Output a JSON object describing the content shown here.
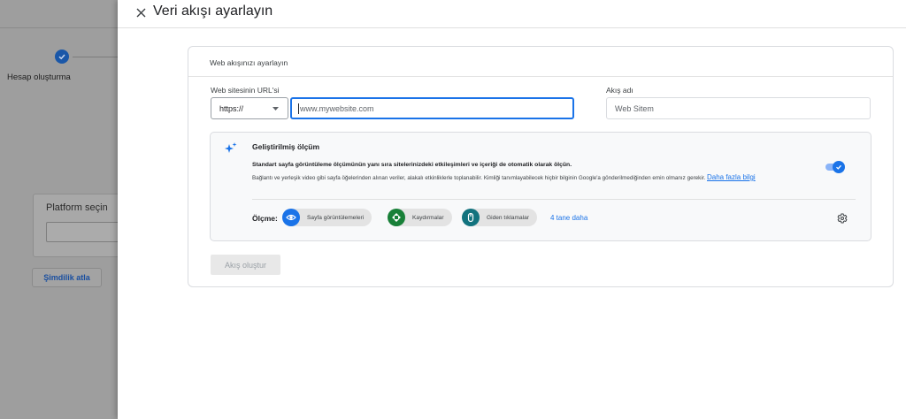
{
  "background": {
    "step_label": "Hesap oluşturma",
    "platform_card_title": "Platform seçin",
    "skip_button": "Şimdilik atla"
  },
  "dialog": {
    "title": "Veri akışı ayarlayın",
    "card_title": "Web akışınızı ayarlayın",
    "url_label": "Web sitesinin URL'si",
    "protocol_value": "https://",
    "url_placeholder": "www.mywebsite.com",
    "stream_name_label": "Akış adı",
    "stream_name_placeholder": "Web Sitem",
    "enhanced": {
      "title": "Geliştirilmiş ölçüm",
      "desc_bold": "Standart sayfa görüntüleme ölçümünün yanı sıra sitelerinizdeki etkileşimleri ve içeriği de otomatik olarak ölçün.",
      "desc_text": "Bağlantı ve yerleşik video gibi sayfa öğelerinden alınan veriler, alakalı etkinliklerle toplanabilir. Kimliği tanımlayabilecek hiçbir bilginin Google'a gönderilmediğinden emin olmanız gerekir.",
      "learn_more": "Daha fazla bilgi",
      "enabled": true,
      "measuring_label": "Ölçme:",
      "chips": [
        {
          "label": "Sayfa görüntülemeleri",
          "icon": "eye-icon",
          "color": "#1a73e8"
        },
        {
          "label": "Kaydırmalar",
          "icon": "scroll-icon",
          "color": "#188038"
        },
        {
          "label": "Giden tıklamalar",
          "icon": "click-icon",
          "color": "#12737e"
        }
      ],
      "more_link": "4 tane daha"
    },
    "create_button": "Akış oluştur"
  },
  "colors": {
    "accent": "#1a73e8",
    "overlay": "#9e9e9e"
  }
}
